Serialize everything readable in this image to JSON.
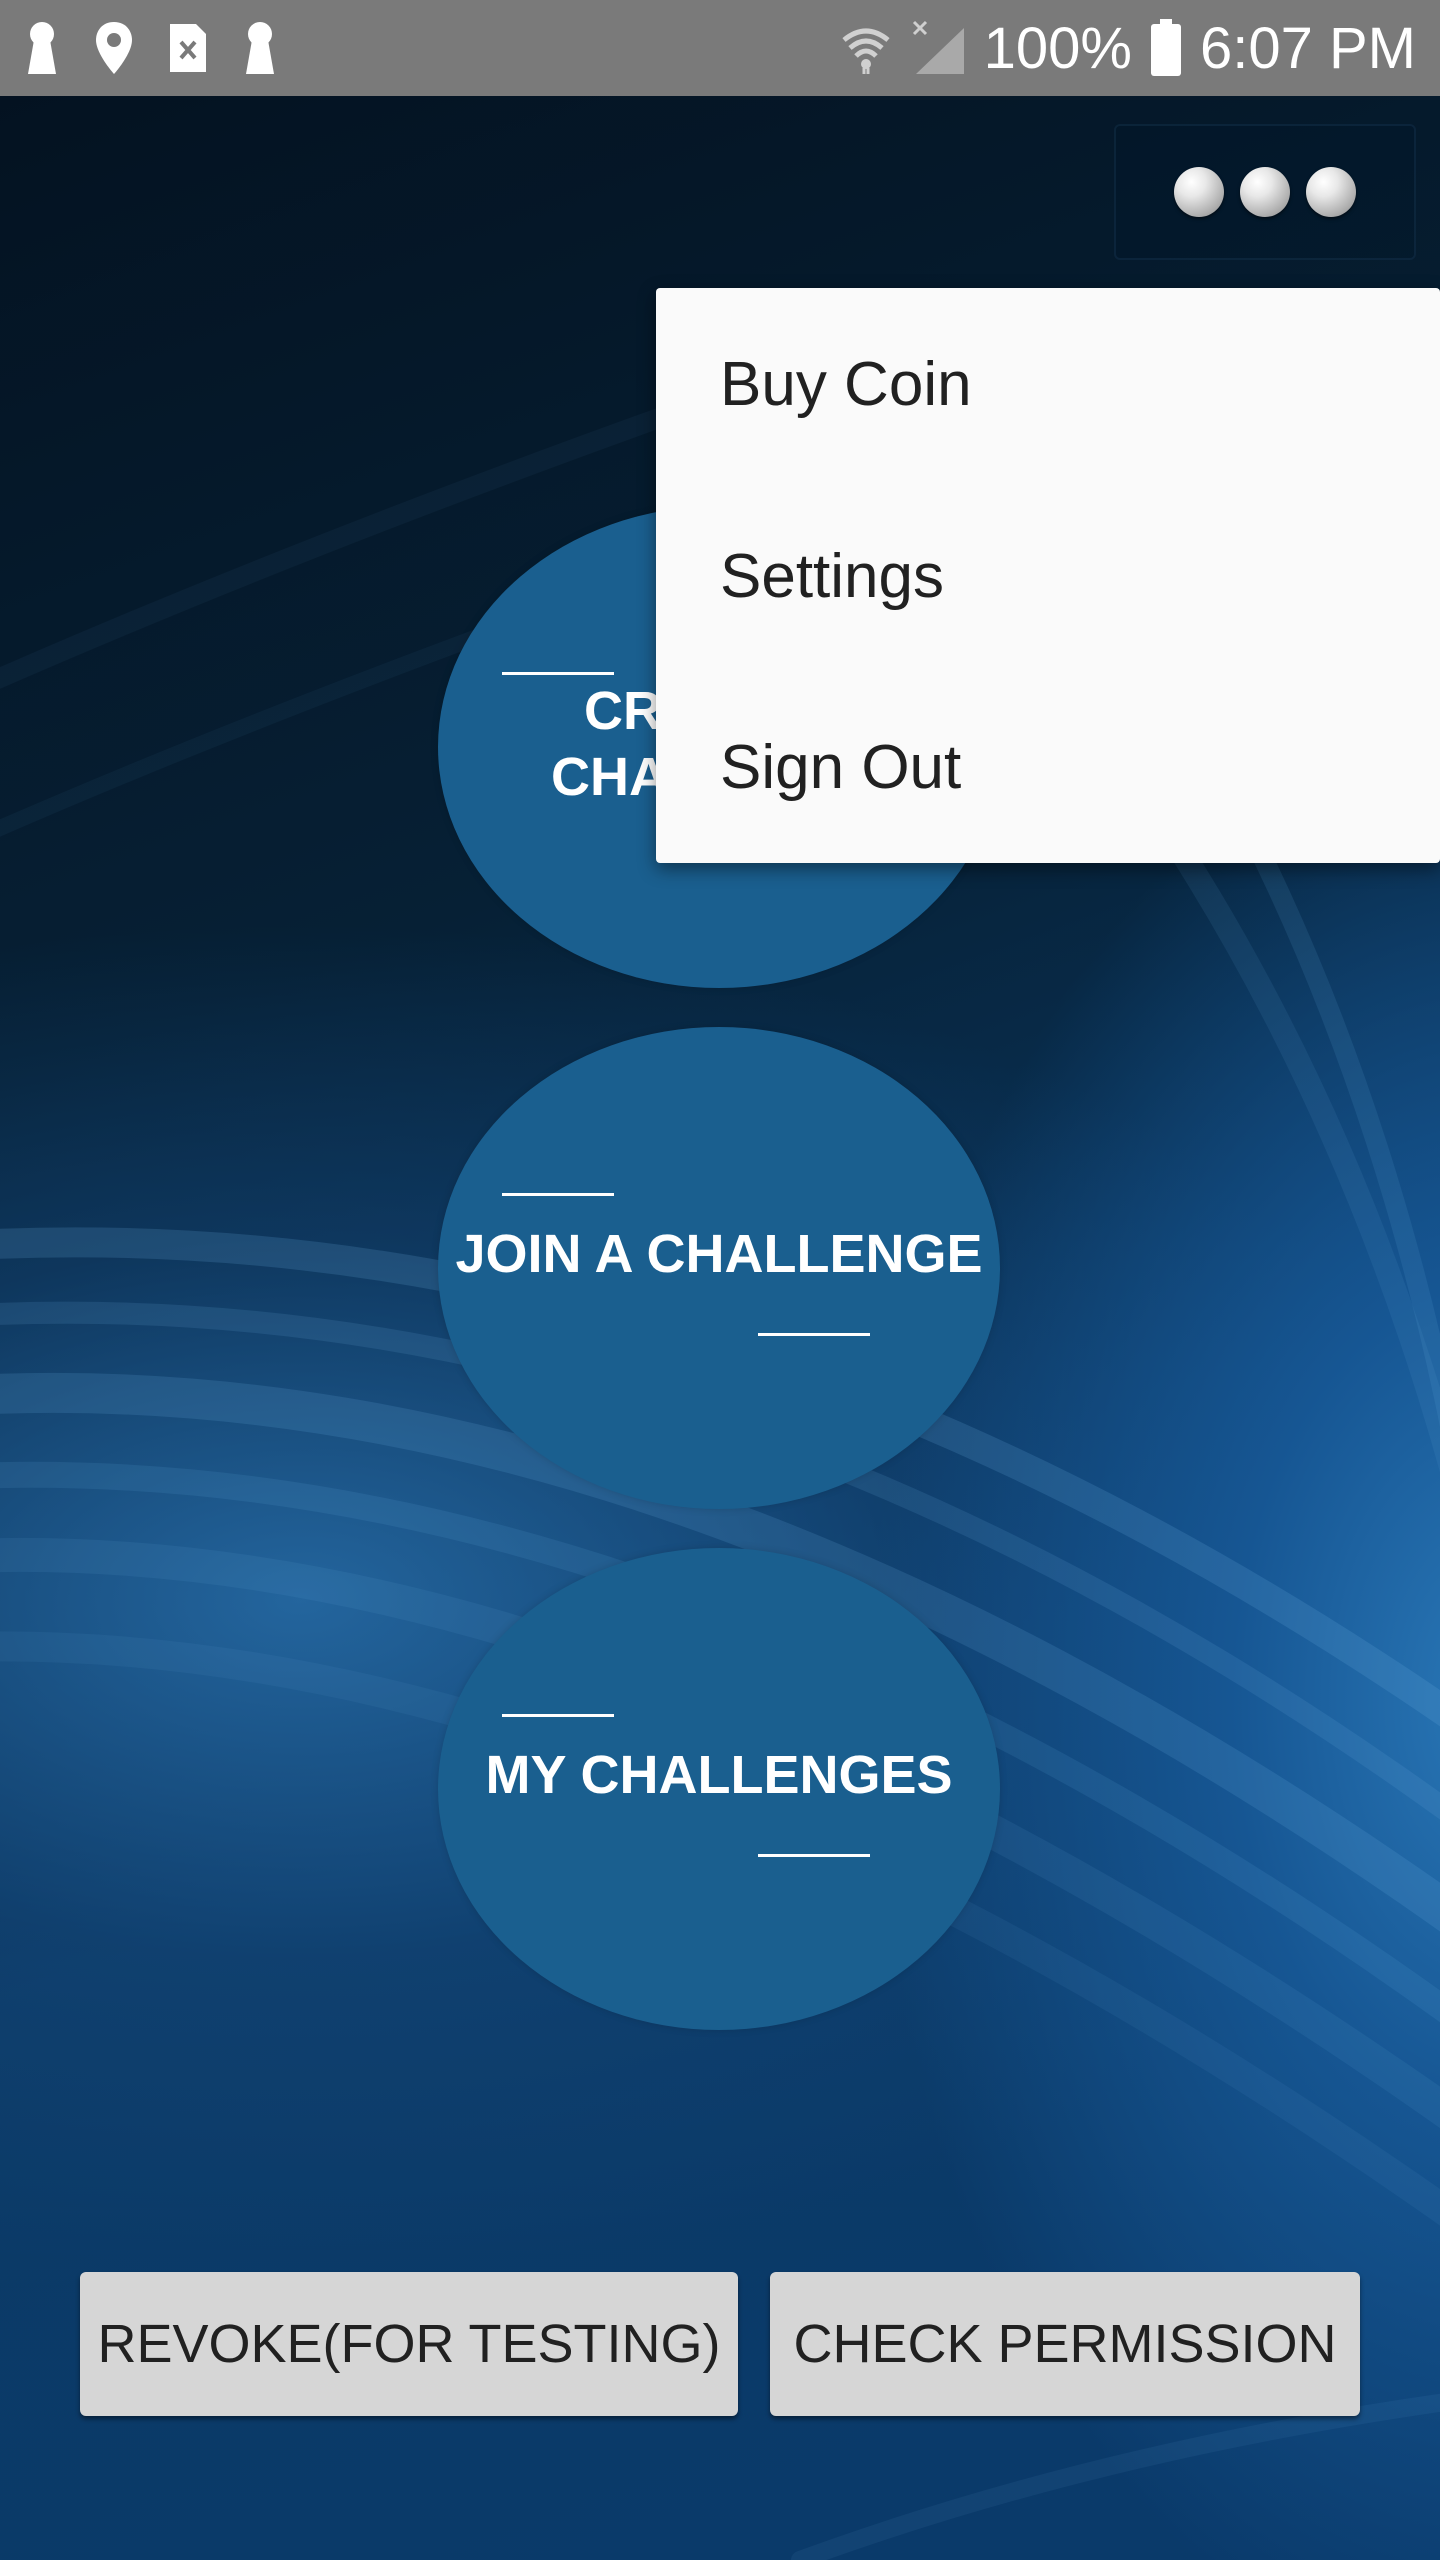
{
  "status_bar": {
    "battery": "100%",
    "time": "6:07 PM",
    "icons_left": [
      "keyhole-icon",
      "location-pin-icon",
      "sim-error-icon",
      "keyhole-icon"
    ],
    "icons_right": [
      "wifi-icon",
      "no-signal-icon",
      "battery-icon"
    ]
  },
  "overflow_menu_button": {
    "icon": "more-dots-icon"
  },
  "menu": {
    "items": [
      {
        "label": "Buy Coin"
      },
      {
        "label": "Settings"
      },
      {
        "label": "Sign Out"
      }
    ]
  },
  "actions": {
    "create_label": "CREATE A CHALLENGE",
    "join_label": "JOIN A CHALLENGE",
    "my_label": "MY CHALLENGES"
  },
  "buttons": {
    "revoke_label": "REVOKE(FOR TESTING)",
    "check_permission_label": "CHECK PERMISSION"
  },
  "colors": {
    "circle": "#1a5f8f",
    "status_bar": "#7a7a7a",
    "menu_bg": "#fafafa",
    "button_bg": "#d6d6d6"
  }
}
